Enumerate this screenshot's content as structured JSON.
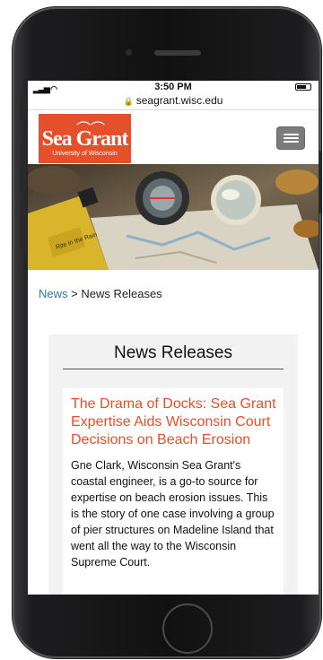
{
  "device": {
    "type": "smartphone"
  },
  "status_bar": {
    "time": "3:50 PM"
  },
  "url_bar": {
    "domain": "seagrant.wisc.edu"
  },
  "header": {
    "logo_text": "Sea Grant",
    "logo_subtext": "University of Wisconsin",
    "menu_icon": "hamburger-icon",
    "brand_color": "#e4502b"
  },
  "breadcrumb": {
    "link": "News",
    "separator": ">",
    "current": "News Releases"
  },
  "main": {
    "section_title": "News Releases",
    "article": {
      "title": "The Drama of Docks: Sea Grant Expertise Aids Wisconsin Court Decisions on Beach Erosion",
      "summary": "Gne Clark, Wisconsin Sea Grant's coastal engineer, is a go-to source for expertise on beach erosion issues. This is the story of one case involving a group of pier structures on Madeline Island that went all the way to the Wisconsin Supreme Court."
    }
  }
}
